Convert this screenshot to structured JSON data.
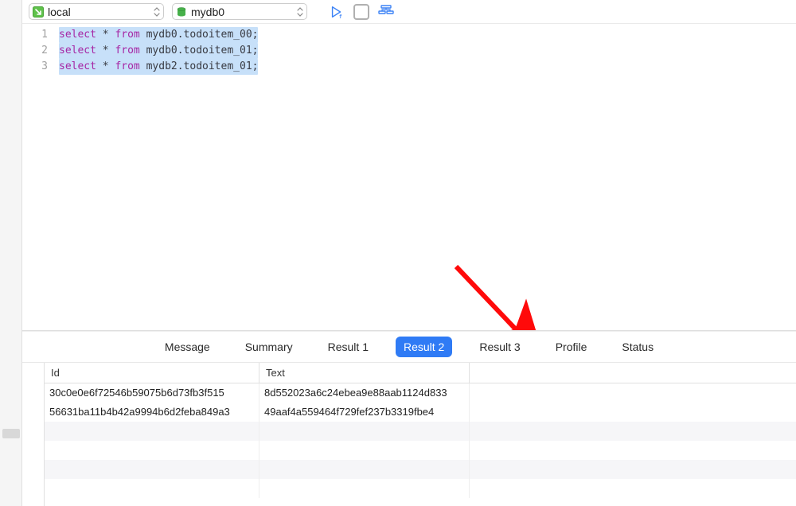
{
  "toolbar": {
    "connection_label": "local",
    "database_label": "mydb0"
  },
  "editor": {
    "lines": [
      {
        "num": "1",
        "prefix": "select",
        "mid": " * ",
        "from": "from",
        "rest": " mydb0.todoitem_00;"
      },
      {
        "num": "2",
        "prefix": "select",
        "mid": " * ",
        "from": "from",
        "rest": " mydb0.todoitem_01;"
      },
      {
        "num": "3",
        "prefix": "select",
        "mid": " * ",
        "from": "from",
        "rest": " mydb2.todoitem_01;"
      }
    ]
  },
  "tabs": {
    "items": [
      {
        "label": "Message",
        "active": false
      },
      {
        "label": "Summary",
        "active": false
      },
      {
        "label": "Result 1",
        "active": false
      },
      {
        "label": "Result 2",
        "active": true
      },
      {
        "label": "Result 3",
        "active": false
      },
      {
        "label": "Profile",
        "active": false
      },
      {
        "label": "Status",
        "active": false
      }
    ]
  },
  "results": {
    "columns": {
      "col1": "Id",
      "col2": "Text"
    },
    "rows": [
      {
        "id": "30c0e0e6f72546b59075b6d73fb3f515",
        "text": "8d552023a6c24ebea9e88aab1124d833"
      },
      {
        "id": "56631ba11b4b42a9994b6d2feba849a3",
        "text": "49aaf4a559464f729fef237b3319fbe4"
      }
    ]
  },
  "colors": {
    "accent": "#2f7bf5",
    "keyword": "#a626a4",
    "arrow": "#ff0a0a"
  }
}
